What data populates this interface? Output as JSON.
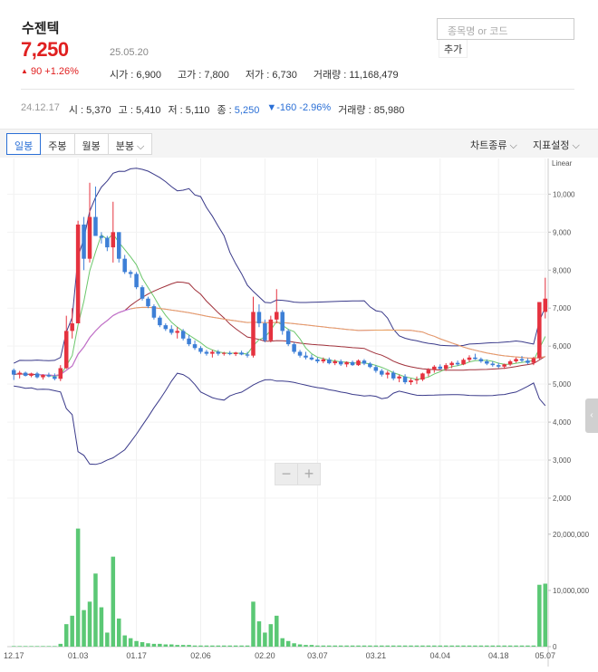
{
  "header": {
    "stock_name": "수젠텍",
    "price": "7,250",
    "change_arrow": "▲",
    "change": "90 +1.26%",
    "date": "25.05.20",
    "stats": [
      {
        "label": "시가",
        "value": "6,900"
      },
      {
        "label": "고가",
        "value": "7,800"
      },
      {
        "label": "저가",
        "value": "6,730"
      },
      {
        "label": "거래량",
        "value": "11,168,479"
      }
    ]
  },
  "search": {
    "placeholder": "종목명 or 코드",
    "add_label": "추가"
  },
  "hover": {
    "date": "24.12.17",
    "open_label": "시",
    "open": "5,370",
    "high_label": "고",
    "high": "5,410",
    "low_label": "저",
    "low": "5,110",
    "close_label": "종",
    "close": "5,250",
    "change": "▼-160 -2.96%",
    "volume_label": "거래량",
    "volume": "85,980"
  },
  "toolbar": {
    "tabs": [
      "일봉",
      "주봉",
      "월봉",
      "분봉"
    ],
    "chart_type": "차트종류",
    "indicator": "지표설정"
  },
  "colors": {
    "up": "#e5323f",
    "down": "#3d7fd6",
    "volume": "#5bc875",
    "accent": "#2a6fd6"
  },
  "chart_data": {
    "type": "candlestick",
    "scale_label": "Linear",
    "price_ticks": [
      "10,000",
      "9,000",
      "8,000",
      "7,000",
      "6,000",
      "5,000",
      "4,000",
      "3,000",
      "2,000"
    ],
    "volume_ticks": [
      "20,000,000",
      "10,000,000",
      "0"
    ],
    "x_ticks": [
      "12.17",
      "01.03",
      "01.17",
      "02.06",
      "02.20",
      "03.07",
      "03.21",
      "04.04",
      "04.18",
      "05.07"
    ],
    "candles": [
      [
        5370,
        5410,
        5110,
        5250
      ],
      [
        5250,
        5350,
        5150,
        5300
      ],
      [
        5300,
        5330,
        5200,
        5220
      ],
      [
        5220,
        5300,
        5180,
        5280
      ],
      [
        5280,
        5320,
        5150,
        5180
      ],
      [
        5180,
        5260,
        5120,
        5240
      ],
      [
        5240,
        5300,
        5180,
        5200
      ],
      [
        5200,
        5280,
        5100,
        5140
      ],
      [
        5140,
        5500,
        5080,
        5420
      ],
      [
        5420,
        6800,
        5400,
        6400
      ],
      [
        6400,
        7000,
        6200,
        6600
      ],
      [
        6600,
        9300,
        6600,
        9200
      ],
      [
        9200,
        9400,
        8000,
        8300
      ],
      [
        8300,
        10300,
        8200,
        9400
      ],
      [
        9400,
        10200,
        9000,
        8900
      ],
      [
        8900,
        9000,
        8700,
        8850
      ],
      [
        8850,
        8900,
        8500,
        8600
      ],
      [
        8600,
        9800,
        8200,
        9000
      ],
      [
        9000,
        9000,
        8200,
        8300
      ],
      [
        8300,
        8400,
        7900,
        7950
      ],
      [
        7950,
        8000,
        7800,
        7900
      ],
      [
        7900,
        7950,
        7500,
        7550
      ],
      [
        7550,
        7600,
        7200,
        7250
      ],
      [
        7250,
        7300,
        7000,
        7050
      ],
      [
        7050,
        7100,
        6700,
        6750
      ],
      [
        6750,
        6800,
        6500,
        6550
      ],
      [
        6550,
        6600,
        6400,
        6450
      ],
      [
        6450,
        6550,
        6300,
        6350
      ],
      [
        6350,
        6500,
        6200,
        6400
      ],
      [
        6400,
        6450,
        6150,
        6200
      ],
      [
        6200,
        6300,
        6000,
        6050
      ],
      [
        6050,
        6150,
        5900,
        5950
      ],
      [
        5950,
        6000,
        5800,
        5850
      ],
      [
        5850,
        5900,
        5750,
        5800
      ],
      [
        5800,
        5900,
        5700,
        5850
      ],
      [
        5850,
        5900,
        5750,
        5800
      ],
      [
        5800,
        5850,
        5750,
        5820
      ],
      [
        5820,
        5870,
        5760,
        5790
      ],
      [
        5790,
        5850,
        5740,
        5830
      ],
      [
        5830,
        5880,
        5760,
        5780
      ],
      [
        5780,
        5850,
        5700,
        5750
      ],
      [
        5750,
        7300,
        5700,
        6900
      ],
      [
        6900,
        7100,
        6500,
        6600
      ],
      [
        6600,
        6700,
        6100,
        6150
      ],
      [
        6150,
        6800,
        6100,
        6700
      ],
      [
        6700,
        7500,
        6600,
        6900
      ],
      [
        6900,
        6950,
        6300,
        6400
      ],
      [
        6400,
        6450,
        6000,
        6050
      ],
      [
        6050,
        6100,
        5800,
        5850
      ],
      [
        5850,
        5900,
        5700,
        5750
      ],
      [
        5750,
        5850,
        5650,
        5700
      ],
      [
        5700,
        5780,
        5620,
        5650
      ],
      [
        5650,
        5700,
        5550,
        5600
      ],
      [
        5600,
        5700,
        5550,
        5650
      ],
      [
        5650,
        5700,
        5520,
        5550
      ],
      [
        5550,
        5650,
        5500,
        5600
      ],
      [
        5600,
        5650,
        5480,
        5520
      ],
      [
        5520,
        5600,
        5450,
        5580
      ],
      [
        5580,
        5620,
        5480,
        5500
      ],
      [
        5500,
        5650,
        5480,
        5620
      ],
      [
        5620,
        5660,
        5500,
        5540
      ],
      [
        5540,
        5580,
        5420,
        5450
      ],
      [
        5450,
        5500,
        5300,
        5350
      ],
      [
        5350,
        5400,
        5200,
        5250
      ],
      [
        5250,
        5350,
        5150,
        5300
      ],
      [
        5300,
        5350,
        5100,
        5150
      ],
      [
        5150,
        5250,
        5050,
        5200
      ],
      [
        5200,
        5260,
        5000,
        5050
      ],
      [
        5050,
        5150,
        4980,
        5100
      ],
      [
        5100,
        5200,
        5000,
        5120
      ],
      [
        5120,
        5300,
        5080,
        5280
      ],
      [
        5280,
        5420,
        5200,
        5380
      ],
      [
        5380,
        5500,
        5300,
        5460
      ],
      [
        5460,
        5520,
        5380,
        5400
      ],
      [
        5400,
        5550,
        5350,
        5500
      ],
      [
        5500,
        5600,
        5420,
        5560
      ],
      [
        5560,
        5620,
        5480,
        5520
      ],
      [
        5520,
        5680,
        5500,
        5640
      ],
      [
        5640,
        5760,
        5580,
        5700
      ],
      [
        5700,
        5800,
        5640,
        5660
      ],
      [
        5660,
        5700,
        5560,
        5600
      ],
      [
        5600,
        5650,
        5500,
        5540
      ],
      [
        5540,
        5600,
        5460,
        5500
      ],
      [
        5500,
        5560,
        5420,
        5460
      ],
      [
        5460,
        5540,
        5400,
        5520
      ],
      [
        5520,
        5640,
        5480,
        5600
      ],
      [
        5600,
        5700,
        5560,
        5660
      ],
      [
        5660,
        5740,
        5580,
        5620
      ],
      [
        5620,
        5680,
        5520,
        5560
      ],
      [
        5560,
        5720,
        5500,
        5680
      ],
      [
        5680,
        7100,
        5650,
        7160
      ],
      [
        6900,
        7800,
        6730,
        7250
      ]
    ],
    "volumes": [
      0.1,
      0.1,
      0.1,
      0.1,
      0.1,
      0.1,
      0.1,
      0.1,
      0.5,
      4.0,
      5.5,
      21.0,
      6.5,
      8.0,
      13.0,
      7.0,
      2.5,
      16.0,
      5.0,
      2.0,
      1.5,
      1.0,
      0.8,
      0.6,
      0.5,
      0.5,
      0.4,
      0.4,
      0.3,
      0.3,
      0.3,
      0.2,
      0.2,
      0.2,
      0.2,
      0.2,
      0.2,
      0.2,
      0.2,
      0.2,
      0.2,
      8.0,
      4.5,
      2.5,
      4.0,
      5.5,
      1.5,
      1.0,
      0.6,
      0.4,
      0.3,
      0.3,
      0.2,
      0.2,
      0.2,
      0.2,
      0.2,
      0.2,
      0.2,
      0.2,
      0.2,
      0.2,
      0.2,
      0.2,
      0.2,
      0.2,
      0.2,
      0.2,
      0.2,
      0.2,
      0.2,
      0.2,
      0.2,
      0.2,
      0.2,
      0.2,
      0.2,
      0.2,
      0.2,
      0.2,
      0.2,
      0.2,
      0.2,
      0.2,
      0.2,
      0.2,
      0.2,
      0.2,
      0.2,
      0.2,
      11.0,
      11.2
    ],
    "price_range": [
      2000,
      10700
    ],
    "volume_range": [
      0,
      24000000
    ]
  }
}
